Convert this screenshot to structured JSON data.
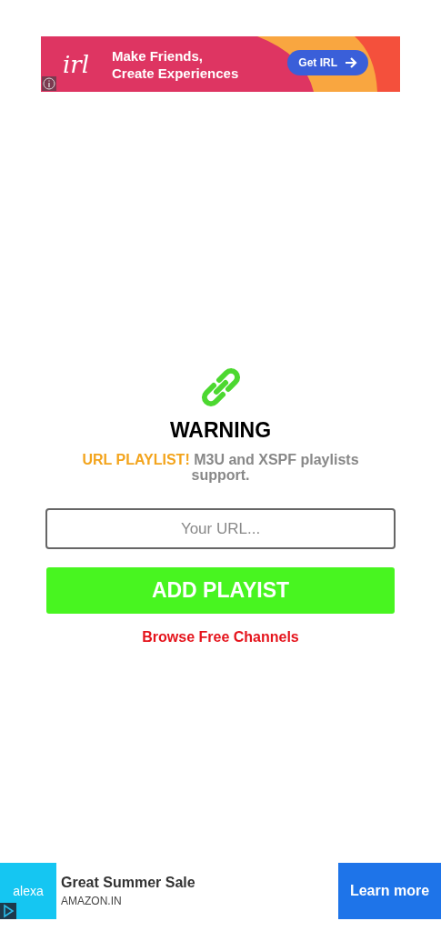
{
  "top_ad": {
    "logo": "irl",
    "headline": "Make Friends,",
    "headline_2": "Create Experiences",
    "button": "Get IRL"
  },
  "warning": {
    "title": "WARNING",
    "highlight": "URL PLAYLIST!",
    "message": "M3U and XSPF playlists support."
  },
  "url_field": {
    "placeholder": "Your URL..."
  },
  "add_button": "ADD PLAYIST",
  "browse_link": "Browse Free Channels",
  "bottom_ad": {
    "logo": "alexa",
    "title": "Great Summer Sale",
    "advertiser": "AMAZON.IN",
    "button": "Learn more"
  }
}
